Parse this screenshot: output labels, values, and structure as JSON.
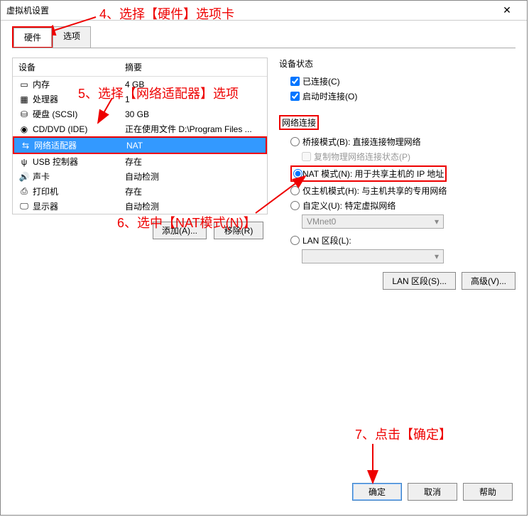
{
  "window": {
    "title": "虚拟机设置"
  },
  "tabs": {
    "hardware": "硬件",
    "options": "选项"
  },
  "table": {
    "header_device": "设备",
    "header_summary": "摘要",
    "rows": [
      {
        "name": "内存",
        "summary": "4 GB",
        "icon": "mem"
      },
      {
        "name": "处理器",
        "summary": "1",
        "icon": "cpu"
      },
      {
        "name": "硬盘 (SCSI)",
        "summary": "30 GB",
        "icon": "hdd"
      },
      {
        "name": "CD/DVD (IDE)",
        "summary": "正在使用文件 D:\\Program Files ...",
        "icon": "cd"
      },
      {
        "name": "网络适配器",
        "summary": "NAT",
        "icon": "net",
        "selected": true
      },
      {
        "name": "USB 控制器",
        "summary": "存在",
        "icon": "usb"
      },
      {
        "name": "声卡",
        "summary": "自动检测",
        "icon": "snd"
      },
      {
        "name": "打印机",
        "summary": "存在",
        "icon": "prn"
      },
      {
        "name": "显示器",
        "summary": "自动检测",
        "icon": "dsp"
      }
    ]
  },
  "left_buttons": {
    "add": "添加(A)...",
    "remove": "移除(R)"
  },
  "status": {
    "title": "设备状态",
    "connected": "已连接(C)",
    "connect_on_power": "启动时连接(O)"
  },
  "network": {
    "title": "网络连接",
    "bridged": "桥接模式(B): 直接连接物理网络",
    "replicate": "复制物理网络连接状态(P)",
    "nat": "NAT 模式(N): 用于共享主机的 IP 地址",
    "hostonly": "仅主机模式(H): 与主机共享的专用网络",
    "custom": "自定义(U): 特定虚拟网络",
    "custom_value": "VMnet0",
    "lan": "LAN 区段(L):",
    "lan_value": ""
  },
  "right_buttons": {
    "lan": "LAN 区段(S)...",
    "adv": "高级(V)..."
  },
  "bottom_buttons": {
    "ok": "确定",
    "cancel": "取消",
    "help": "帮助"
  },
  "annotations": {
    "a4": "4、选择【硬件】选项卡",
    "a5": "5、选择【网络适配器】选项",
    "a6": "6、选中【NAT模式(N)】",
    "a7": "7、点击【确定】"
  }
}
